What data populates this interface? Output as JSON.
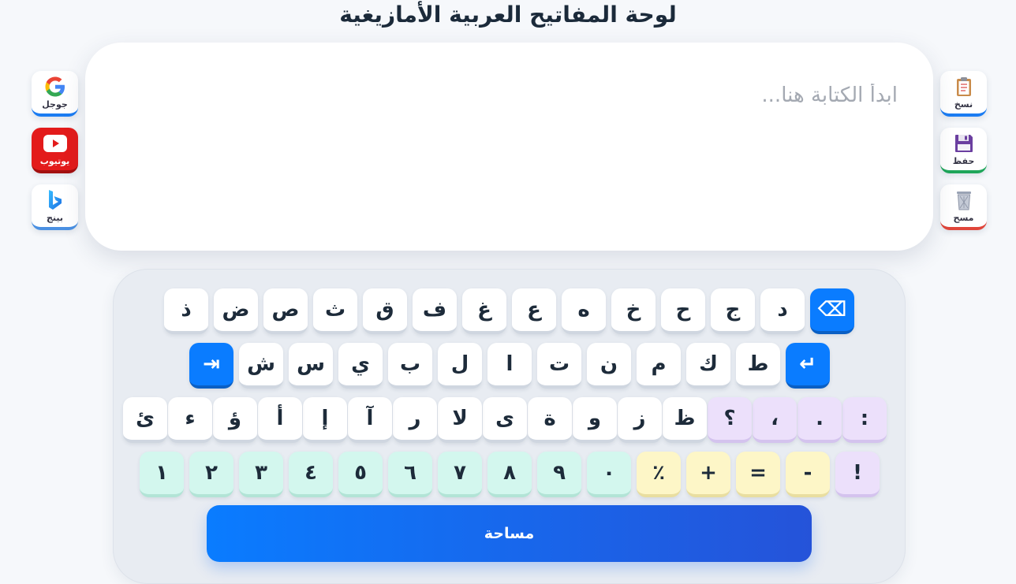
{
  "page": {
    "title": "لوحة المفاتيح العربية الأمازيغية"
  },
  "editor": {
    "placeholder": "ابدأ الكتابة هنا...",
    "value": ""
  },
  "left_actions": [
    {
      "label": "جوجل",
      "icon": "google-icon"
    },
    {
      "label": "يوتيوب",
      "icon": "youtube-icon"
    },
    {
      "label": "بينج",
      "icon": "bing-icon"
    }
  ],
  "right_actions": [
    {
      "label": "نسخ",
      "icon": "clipboard-icon"
    },
    {
      "label": "حفظ",
      "icon": "floppy-disk-icon"
    },
    {
      "label": "مسح",
      "icon": "trash-icon"
    }
  ],
  "keyboard": {
    "row1": [
      "ذ",
      "ض",
      "ص",
      "ث",
      "ق",
      "ف",
      "غ",
      "ع",
      "ه",
      "خ",
      "ح",
      "ج",
      "د",
      "⌫"
    ],
    "row2": [
      "⇥",
      "ش",
      "س",
      "ي",
      "ب",
      "ل",
      "ا",
      "ت",
      "ن",
      "م",
      "ك",
      "ط",
      "↵"
    ],
    "row3": [
      "ئ",
      "ء",
      "ؤ",
      "أ",
      "إ",
      "آ",
      "ر",
      "لا",
      "ى",
      "ة",
      "و",
      "ز",
      "ظ",
      "؟",
      "،",
      ".",
      ":"
    ],
    "row4": [
      "١",
      "٢",
      "٣",
      "٤",
      "٥",
      "٦",
      "٧",
      "٨",
      "٩",
      "٠",
      "٪",
      "+",
      "=",
      "-",
      "!"
    ],
    "space_label": "مساحة"
  },
  "colors": {
    "accent": "#0a7cff",
    "accent_dark": "#2553d9",
    "lavender": "#ece0fb",
    "yellow": "#fdf6c7",
    "mint": "#d3f7ee",
    "youtube_red": "#e31b1b"
  }
}
